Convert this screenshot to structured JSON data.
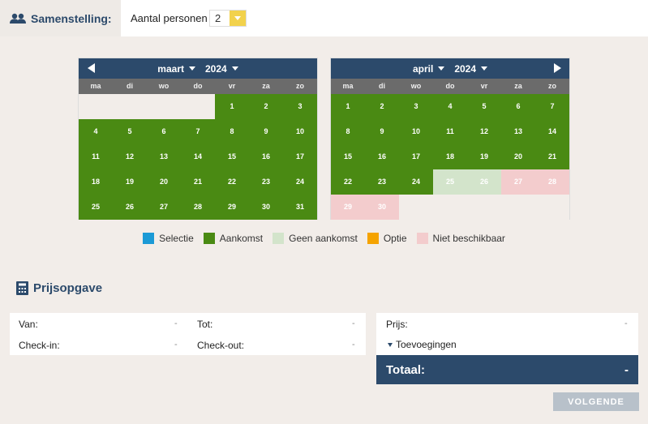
{
  "composition": {
    "title": "Samenstelling:",
    "persons_label": "Aantal personen",
    "persons_value": "2"
  },
  "calendars": [
    {
      "month": "maart",
      "year": "2024",
      "weekdays": [
        "ma",
        "di",
        "wo",
        "do",
        "vr",
        "za",
        "zo"
      ],
      "leading_blanks": 4,
      "days": [
        {
          "d": "1",
          "s": "green"
        },
        {
          "d": "2",
          "s": "green"
        },
        {
          "d": "3",
          "s": "green"
        },
        {
          "d": "4",
          "s": "green"
        },
        {
          "d": "5",
          "s": "green"
        },
        {
          "d": "6",
          "s": "green"
        },
        {
          "d": "7",
          "s": "green"
        },
        {
          "d": "8",
          "s": "green"
        },
        {
          "d": "9",
          "s": "green"
        },
        {
          "d": "10",
          "s": "green"
        },
        {
          "d": "11",
          "s": "green"
        },
        {
          "d": "12",
          "s": "green"
        },
        {
          "d": "13",
          "s": "green"
        },
        {
          "d": "14",
          "s": "green"
        },
        {
          "d": "15",
          "s": "green"
        },
        {
          "d": "16",
          "s": "green"
        },
        {
          "d": "17",
          "s": "green"
        },
        {
          "d": "18",
          "s": "green"
        },
        {
          "d": "19",
          "s": "green"
        },
        {
          "d": "20",
          "s": "green"
        },
        {
          "d": "21",
          "s": "green"
        },
        {
          "d": "22",
          "s": "green"
        },
        {
          "d": "23",
          "s": "green"
        },
        {
          "d": "24",
          "s": "green"
        },
        {
          "d": "25",
          "s": "green"
        },
        {
          "d": "26",
          "s": "green"
        },
        {
          "d": "27",
          "s": "green"
        },
        {
          "d": "28",
          "s": "green"
        },
        {
          "d": "29",
          "s": "green"
        },
        {
          "d": "30",
          "s": "green"
        },
        {
          "d": "31",
          "s": "green"
        }
      ],
      "trailing_blanks": 0
    },
    {
      "month": "april",
      "year": "2024",
      "weekdays": [
        "ma",
        "di",
        "wo",
        "do",
        "vr",
        "za",
        "zo"
      ],
      "leading_blanks": 0,
      "days": [
        {
          "d": "1",
          "s": "green"
        },
        {
          "d": "2",
          "s": "green"
        },
        {
          "d": "3",
          "s": "green"
        },
        {
          "d": "4",
          "s": "green"
        },
        {
          "d": "5",
          "s": "green"
        },
        {
          "d": "6",
          "s": "green"
        },
        {
          "d": "7",
          "s": "green"
        },
        {
          "d": "8",
          "s": "green"
        },
        {
          "d": "9",
          "s": "green"
        },
        {
          "d": "10",
          "s": "green"
        },
        {
          "d": "11",
          "s": "green"
        },
        {
          "d": "12",
          "s": "green"
        },
        {
          "d": "13",
          "s": "green"
        },
        {
          "d": "14",
          "s": "green"
        },
        {
          "d": "15",
          "s": "green"
        },
        {
          "d": "16",
          "s": "green"
        },
        {
          "d": "17",
          "s": "green"
        },
        {
          "d": "18",
          "s": "green"
        },
        {
          "d": "19",
          "s": "green"
        },
        {
          "d": "20",
          "s": "green"
        },
        {
          "d": "21",
          "s": "green"
        },
        {
          "d": "22",
          "s": "green"
        },
        {
          "d": "23",
          "s": "green"
        },
        {
          "d": "24",
          "s": "green"
        },
        {
          "d": "25",
          "s": "lightgreen"
        },
        {
          "d": "26",
          "s": "lightgreen"
        },
        {
          "d": "27",
          "s": "pink"
        },
        {
          "d": "28",
          "s": "pink"
        },
        {
          "d": "29",
          "s": "pink"
        },
        {
          "d": "30",
          "s": "pink"
        }
      ],
      "trailing_blanks": 5
    }
  ],
  "legend": [
    {
      "label": "Selectie",
      "color": "#1b9ad6"
    },
    {
      "label": "Aankomst",
      "color": "#4a8a13"
    },
    {
      "label": "Geen aankomst",
      "color": "#d3e4cb"
    },
    {
      "label": "Optie",
      "color": "#f5a300"
    },
    {
      "label": "Niet beschikbaar",
      "color": "#f3cccd"
    }
  ],
  "price": {
    "title": "Prijsopgave",
    "van_label": "Van:",
    "van_value": "-",
    "tot_label": "Tot:",
    "tot_value": "-",
    "checkin_label": "Check-in:",
    "checkin_value": "-",
    "checkout_label": "Check-out:",
    "checkout_value": "-",
    "prijs_label": "Prijs:",
    "prijs_value": "-",
    "toevoegingen_label": "Toevoegingen",
    "totaal_label": "Totaal:",
    "totaal_value": "-",
    "next_button": "VOLGENDE"
  },
  "colors": {
    "primary": "#2c4a6b",
    "available": "#4a8a13",
    "no_arrival": "#d3e4cb",
    "unavailable": "#f3cccd",
    "accent_yellow": "#f2d24c",
    "button_disabled": "#b8c1ca"
  }
}
